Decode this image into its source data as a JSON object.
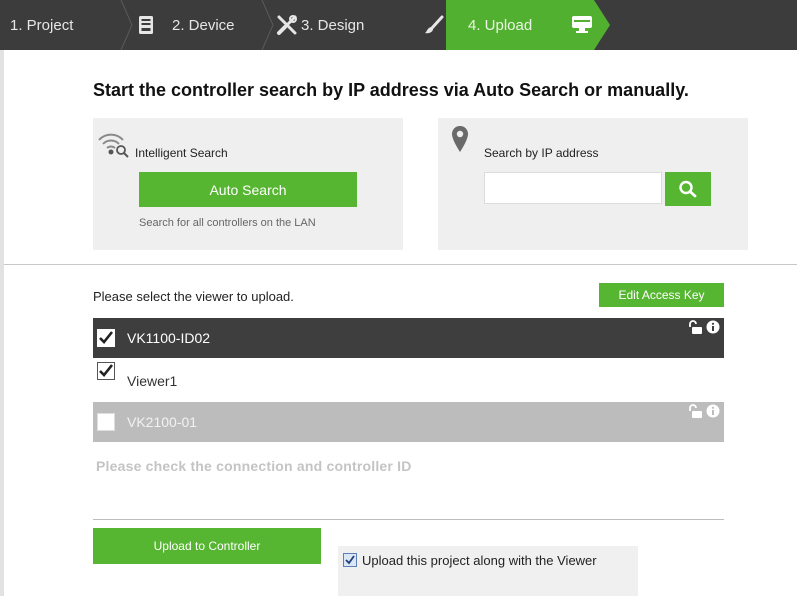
{
  "steps": [
    {
      "label": "1. Project",
      "icon": "none"
    },
    {
      "label": "2. Device",
      "icon": "device-icon"
    },
    {
      "label": "3. Design",
      "icon": "tools-icon"
    },
    {
      "label": "4. Upload",
      "icon": "brush-icon"
    }
  ],
  "active_step_icon": "upload-monitor-icon",
  "headline": "Start the controller search by IP address via Auto Search or manually.",
  "intelligent_search": {
    "title": "Intelligent Search",
    "button_label": "Auto Search",
    "hint": "Search for all controllers on the LAN"
  },
  "ip_search": {
    "title": "Search by IP address",
    "input_value": "",
    "button_icon": "search-icon"
  },
  "viewer_select": {
    "label": "Please select the viewer to upload.",
    "edit_key_label": "Edit Access Key"
  },
  "viewers": [
    {
      "name": "VK1100-ID02",
      "checked": true,
      "style": "selected",
      "lock_icon": "unlock-icon",
      "info_icon": "info-icon"
    },
    {
      "name": "Viewer1",
      "checked": true,
      "style": "plain"
    },
    {
      "name": "VK2100-01",
      "checked": false,
      "style": "disabled",
      "lock_icon": "unlock-icon",
      "info_icon": "info-icon"
    }
  ],
  "connection_message": "Please check the connection and controller ID",
  "upload": {
    "button_label": "Upload to Controller",
    "option_label": "Upload this project along with the Viewer",
    "option_checked": true
  },
  "colors": {
    "accent_green": "#56b632",
    "stepbar_bg": "#3c3c3c",
    "selected_row": "#3e3e3e",
    "disabled_row": "#bcbcbc"
  }
}
